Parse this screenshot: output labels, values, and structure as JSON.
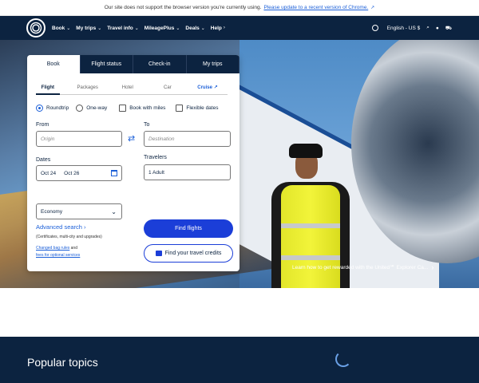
{
  "banner": {
    "text": "Our site does not support the browser version you're currently using.",
    "link": "Please update to a recent version of Chrome.",
    "link_icon": "↗"
  },
  "nav": {
    "items": [
      "Book",
      "My trips",
      "Travel info",
      "MileagePlus",
      "Deals",
      "Help"
    ],
    "language": "English - US $"
  },
  "hero": {
    "promo": "Learn how to get rewarded with the United℠ Explorer Ca..."
  },
  "booking": {
    "tabs": [
      "Book",
      "Flight status",
      "Check-in",
      "My trips"
    ],
    "subtabs": [
      "Flight",
      "Packages",
      "Hotel",
      "Car",
      "Cruise"
    ],
    "options": {
      "roundtrip": "Roundtrip",
      "oneway": "One-way",
      "miles": "Book with miles",
      "flexible": "Flexible dates"
    },
    "from_label": "From",
    "to_label": "To",
    "origin_placeholder": "Origin",
    "destination_placeholder": "Destination",
    "dates_label": "Dates",
    "depart": "Oct 24",
    "return": "Oct 26",
    "travelers_label": "Travelers",
    "travelers": "1 Adult",
    "cabin": "Economy",
    "advanced": "Advanced search",
    "advanced_sub": "(Certificates, multi-city and upgrades)",
    "link1": "Changed bag rules",
    "link_and": "and",
    "link2": "fees for optional services",
    "find_flights": "Find flights",
    "find_credits": "Find your travel credits"
  },
  "popular": {
    "title": "Popular topics"
  }
}
